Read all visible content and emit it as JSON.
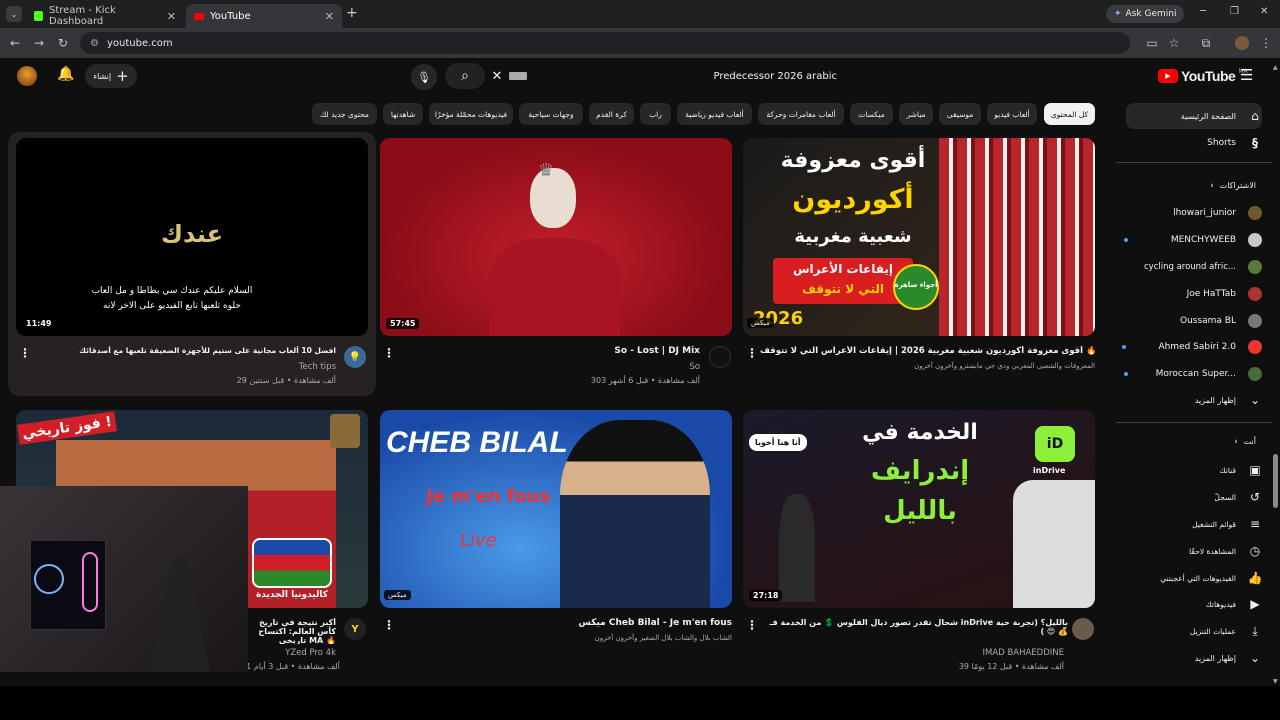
{
  "browser": {
    "tabs": [
      {
        "title": "Stream - Kick Dashboard",
        "active": false
      },
      {
        "title": "YouTube",
        "active": true
      }
    ],
    "ask_gemini": "Ask Gemini",
    "url": "youtube.com"
  },
  "header": {
    "create_label": "إنشاء",
    "search_query": "Predecessor 2026 arabic",
    "logo_text": "YouTube",
    "logo_region": "MA"
  },
  "chips": [
    "كل المحتوى",
    "ألعاب فيديو",
    "موسيقى",
    "مباشر",
    "ميكسات",
    "ألعاب مغامرات وحركة",
    "ألعاب فيديو رياضية",
    "راب",
    "كرة القدم",
    "وجهات سياحية",
    "فيديوهات محمّلة مؤخرًا",
    "شاهدتها",
    "محتوى جديد لك"
  ],
  "sidebar": {
    "home": "الصفحة الرئيسية",
    "shorts": "Shorts",
    "subscriptions_title": "الاشتراكات",
    "subscriptions": [
      {
        "name": "lhowari_junior",
        "dot": false,
        "color": "#6b5a2a"
      },
      {
        "name": "MENCHYWEEB",
        "dot": true,
        "color": "#c9c9c9"
      },
      {
        "name": "cycling around afric...",
        "dot": false,
        "color": "#5a7a3a"
      },
      {
        "name": "Joe HaTTab",
        "dot": false,
        "color": "#a33"
      },
      {
        "name": "Oussama BL",
        "dot": false,
        "color": "#777"
      },
      {
        "name": "Ahmed Sabiri 2.0",
        "dot": true,
        "color": "#e33"
      },
      {
        "name": "Moroccan Super...",
        "dot": true,
        "color": "#4a6a3a"
      }
    ],
    "show_more_1": "إظهار المزيد",
    "you_title": "أنت",
    "you_items": [
      "قناتك",
      "السجلّ",
      "قوائم التشغيل",
      "المشاهدة لاحقًا",
      "الفيديوهات التي أعجبتني",
      "فيديوهاتك",
      "عمليات التنزيل"
    ],
    "show_more_2": "إظهار المزيد"
  },
  "videos": [
    {
      "title": "افضل 10 ألعاب مجانية على ستيم للأجهزة الضعيفة تلعبها مع أصدقائك",
      "channel": "Tech tips",
      "meta": "29 ألف مشاهدة • قبل سنتين",
      "duration": "11:49",
      "thumb_main": "عندك",
      "thumb_sub1": "السلام عليكم عندك سي بطاطا و مل العاب",
      "thumb_sub2": "حلوه تلعبها تابع الفيديو على الاخر لانه"
    },
    {
      "title": "So - Lost | DJ Mix",
      "channel": "So",
      "meta": "303 ألف مشاهدة • قبل 6 أشهر",
      "duration": "57:45"
    },
    {
      "title": "ميكس 🔥 أقوى معزوفة أكورديون شعبية مغربية 2026 | إيقاعات الأعراس التي لا تتوقف",
      "channel": "المعزوفات والشعبي المغربي ودي جي مايسترو وآخرون آخرون",
      "meta": "",
      "duration": "",
      "thumb_l1": "أقوى معزوفة",
      "thumb_l2": "أكورديون",
      "thumb_l3": "شعبية مغربية",
      "thumb_l4": "إيقاعات الأعراس",
      "thumb_l5": "التي لا تتوقف",
      "thumb_year": "2026",
      "thumb_badge": "أجواء ساهرة",
      "thumb_mix": "ميكس"
    },
    {
      "title": "أكبر نتيجة في تاريخ كأس العالم: اكتساح تاريخي MA 🔥",
      "channel": "YZed Pro 4k",
      "meta": "121 ألف مشاهدة • قبل 3 أيام",
      "duration": "",
      "thumb_l1": "فوز تاريخي !",
      "thumb_l2": "كاليدونيا الجديدة"
    },
    {
      "title": "ميكس Cheb Bilal - Je m'en fous",
      "channel": "الشاب بلال والشاب بلال الصغير وآخرون آخرون",
      "meta": "",
      "duration": "",
      "thumb_l1": "CHEB BILAL",
      "thumb_l2": "Je m'en fous",
      "thumb_l3": "Live",
      "thumb_mix": "ميكس"
    },
    {
      "title": "شحال تقدر تصور ديال الفلوس 💲 من الخدمة فـ inDrive بالليل؟ (تجربة حية 😍 ) 💰",
      "channel": "IMAD BAHAEDDINE",
      "meta": "39 ألف مشاهدة • قبل 12 يومًا",
      "duration": "27:18",
      "thumb_l1": "الخدمة في",
      "thumb_l2": "إندرايف",
      "thumb_l3": "بالليل",
      "thumb_bubble": "أنا هنا أخويا",
      "thumb_brand": "inDrive"
    }
  ],
  "colors": {
    "accent": "#ff0000",
    "chip_selected": "#f1f1f1",
    "link_blue": "#3ea6ff"
  }
}
